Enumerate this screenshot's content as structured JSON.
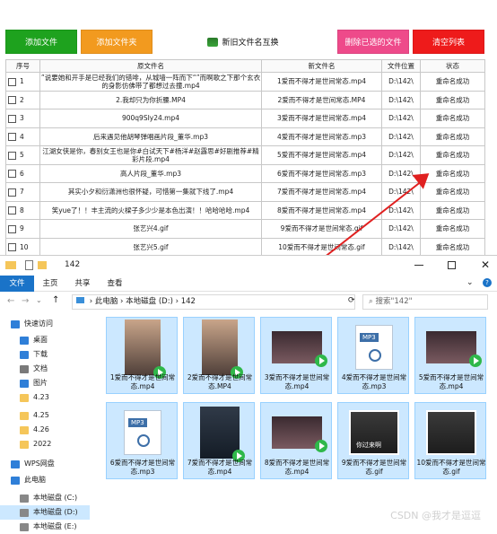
{
  "toolbar": {
    "add_file": "添加文件",
    "add_folder": "添加文件夹",
    "swap": "新旧文件名互换",
    "delete_selected": "删除已选的文件",
    "clear_list": "清空列表"
  },
  "table": {
    "headers": [
      "序号",
      "原文件名",
      "新文件名",
      "文件位置",
      "状态"
    ],
    "rows": [
      {
        "no": "1",
        "orig": "”说要她和开手是已经我们的错啡，从城墙一阵而下“”而啊歌之下那个玄衣的身影仿佛带了都想过去撞.mp4",
        "new": "1爱而不得才是世间常态.mp4",
        "loc": "D:\\142\\",
        "status": "重命名成功"
      },
      {
        "no": "2",
        "orig": "2.我却只为你折腰.MP4",
        "new": "2爱而不得才是世间常态.MP4",
        "loc": "D:\\142\\",
        "status": "重命名成功"
      },
      {
        "no": "3",
        "orig": "900q9SIy24.mp4",
        "new": "3爱而不得才是世间常态.mp4",
        "loc": "D:\\142\\",
        "status": "重命名成功"
      },
      {
        "no": "4",
        "orig": "后来遇见他胡琴弹唱画片段_董华.mp3",
        "new": "4爱而不得才是世间常态.mp3",
        "loc": "D:\\142\\",
        "status": "重命名成功"
      },
      {
        "no": "5",
        "orig": "江湖女侠是你，春别女王也是你#白试天下#杨洋#赵露思#好剧推荐#精彩片段.mp4",
        "new": "5爱而不得才是世间常态.mp4",
        "loc": "D:\\142\\",
        "status": "重命名成功"
      },
      {
        "no": "6",
        "orig": "高人片段_董华.mp3",
        "new": "6爱而不得才是世间常态.mp3",
        "loc": "D:\\142\\",
        "status": "重命名成功"
      },
      {
        "no": "7",
        "orig": "其实小夕和衍潇洲也很怀疑，可惜第一集就下线了.mp4",
        "new": "7爱而不得才是世间常态.mp4",
        "loc": "D:\\142\\",
        "status": "重命名成功"
      },
      {
        "no": "8",
        "orig": "笑yue了！！丰主流的火樑子多少少是本色出演！！哈哈哈哈.mp4",
        "new": "8爱而不得才是世间常态.mp4",
        "loc": "D:\\142\\",
        "status": "重命名成功"
      },
      {
        "no": "9",
        "orig": "张艺兴4.gif",
        "new": "9爱而不得才是世间常态.gif",
        "loc": "D:\\142\\",
        "status": "重命名成功"
      },
      {
        "no": "10",
        "orig": "张艺兴5.gif",
        "new": "10爱而不得才是世间常态.gif",
        "loc": "D:\\142\\",
        "status": "重命名成功"
      }
    ]
  },
  "explorer": {
    "title": "142",
    "tabs": [
      "文件",
      "主页",
      "共享",
      "查看"
    ],
    "path": [
      "此电脑",
      "本地磁盘 (D:)",
      "142"
    ],
    "search_placeholder": "搜索\"142\"",
    "nav": [
      "快速访问",
      "桌面",
      "下载",
      "文档",
      "图片",
      "4.23",
      "4.25",
      "4.26",
      "2022",
      "WPS网盘",
      "此电脑",
      "本地磁盘 (C:)",
      "本地磁盘 (D:)",
      "本地磁盘 (E:)"
    ],
    "files": [
      {
        "name": "1爱而不得才是世间常态.mp4",
        "kind": "video"
      },
      {
        "name": "2爱而不得才是世间常态.MP4",
        "kind": "video"
      },
      {
        "name": "3爱而不得才是世间常态.mp4",
        "kind": "video-wide"
      },
      {
        "name": "4爱而不得才是世间常态.mp3",
        "kind": "mp3"
      },
      {
        "name": "5爱而不得才是世间常态.mp4",
        "kind": "video-wide"
      },
      {
        "name": "6爱而不得才是世间常态.mp3",
        "kind": "mp3"
      },
      {
        "name": "7爱而不得才是世间常态.mp4",
        "kind": "video-dark"
      },
      {
        "name": "8爱而不得才是世间常态.mp4",
        "kind": "video-wide"
      },
      {
        "name": "9爱而不得才是世间常态.gif",
        "kind": "gif"
      },
      {
        "name": "10爱而不得才是世间常态.gif",
        "kind": "gif"
      }
    ],
    "mp3_label": "MP3",
    "gif_caption": "你过来啊"
  },
  "watermark": "CSDN @我才是逗逗",
  "colors": {
    "green": "#1ea21e",
    "orange": "#f29a1f",
    "pink": "#ee4a8a",
    "red": "#ee1b1b",
    "selected": "#cce8ff",
    "arrow": "#e02020"
  }
}
